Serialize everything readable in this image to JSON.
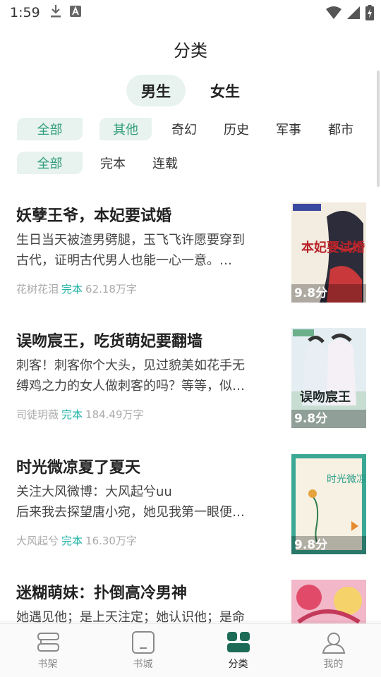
{
  "status_bar": {
    "time": "1:59"
  },
  "page": {
    "title": "分类"
  },
  "gender_tabs": [
    {
      "label": "男生"
    },
    {
      "label": "女生"
    }
  ],
  "categories": [
    {
      "label": "全部"
    },
    {
      "label": "其他"
    },
    {
      "label": "奇幻"
    },
    {
      "label": "历史"
    },
    {
      "label": "军事"
    },
    {
      "label": "都市"
    }
  ],
  "statuses": [
    {
      "label": "全部"
    },
    {
      "label": "完本"
    },
    {
      "label": "连载"
    }
  ],
  "books": [
    {
      "title": "妖孽王爷，本妃要试婚",
      "desc_line1": "生日当天被渣男劈腿，玉飞飞许愿要穿到",
      "desc_line2": "古代，证明古代男人也能一心一意。…",
      "author": "花树花泪",
      "status": "完本",
      "words": "62.18万字",
      "score": "9.8分",
      "cover_text": "本妃要试婚"
    },
    {
      "title": "误吻宸王，吃货萌妃要翻墙",
      "desc_line1": "刺客！刺客你个大头，见过貌美如花手无",
      "desc_line2": "缚鸡之力的女人做刺客的吗？等等，似…",
      "author": "司徒玥薇",
      "status": "完本",
      "words": "184.49万字",
      "score": "9.8分",
      "cover_text": "误吻宸王"
    },
    {
      "title": "时光微凉夏了夏天",
      "desc_line1": "关注大风微博：大风起兮uu",
      "desc_line2": "后来我去探望唐小宛，她见我第一眼便…",
      "author": "大风起兮",
      "status": "完本",
      "words": "16.30万字",
      "score": "9.8分",
      "cover_text": "时光微凉夏天"
    },
    {
      "title": "迷糊萌妹：扑倒高冷男神",
      "desc_line1": "她遇见他；是上天注定；她认识他；是命",
      "desc_line2": "",
      "author": "",
      "status": "",
      "words": "",
      "score": "",
      "cover_text": ""
    }
  ],
  "bottom_nav": [
    {
      "label": "书架",
      "icon": "bookshelf-icon"
    },
    {
      "label": "书城",
      "icon": "bookstore-icon"
    },
    {
      "label": "分类",
      "icon": "category-icon"
    },
    {
      "label": "我的",
      "icon": "profile-icon"
    }
  ],
  "colors": {
    "accent": "#2f9c7a",
    "chip_bg": "#e8f3ef",
    "status_text": "#21b3a6",
    "nav_active": "#1d6b57"
  }
}
